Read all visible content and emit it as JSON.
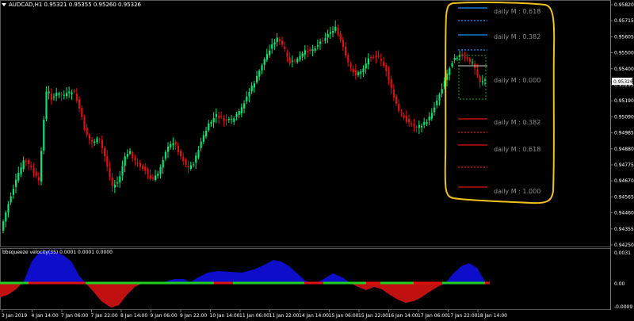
{
  "window": {
    "symbol_info": "AUDCAD,H1  0.95321 0.95355 0.95260 0.95326"
  },
  "indicator": {
    "title": "bbsqueeze velocity(35) 0.0001 0.0001 0.0000",
    "scale_labels": [
      "0.0031",
      "0.00",
      "-0.0009"
    ]
  },
  "price_axis": {
    "labels": [
      "0.95820",
      "0.95715",
      "0.95605",
      "0.95500",
      "0.95400",
      "0.95295",
      "0.95190",
      "0.95090",
      "0.94985",
      "0.94880",
      "0.94775",
      "0.94670",
      "0.94565",
      "0.94460",
      "0.94355",
      "0.94250"
    ],
    "current_price": "0.95326"
  },
  "time_axis": {
    "labels": [
      "3 Jan 2019",
      "4 Jan 14:00",
      "7 Jan 06:00",
      "7 Jan 22:00",
      "8 Jan 14:00",
      "9 Jan 06:00",
      "9 Jan 22:00",
      "10 Jan 14:00",
      "11 Jan 06:00",
      "11 Jan 22:00",
      "14 Jan 14:00",
      "15 Jan 06:00",
      "15 Jan 22:00",
      "16 Jan 14:00",
      "17 Jan 06:00",
      "17 Jan 22:00",
      "18 Jan 14:00"
    ]
  },
  "fib_levels": {
    "labels": [
      "daily M : 0.618",
      "daily M : 0.382",
      "daily M : 0.000",
      "daily M : 0.382",
      "daily M : 0.618",
      "daily M : 1.000"
    ]
  },
  "colors": {
    "background": "#000000",
    "bull": "#00e676",
    "bear": "#e01010",
    "highlight": "#f0c020",
    "fib_blue": "#1e90ff",
    "fib_red": "#e01010",
    "hist_blue": "#1010e0",
    "hist_red": "#c01010",
    "signal_green": "#20d020"
  }
}
